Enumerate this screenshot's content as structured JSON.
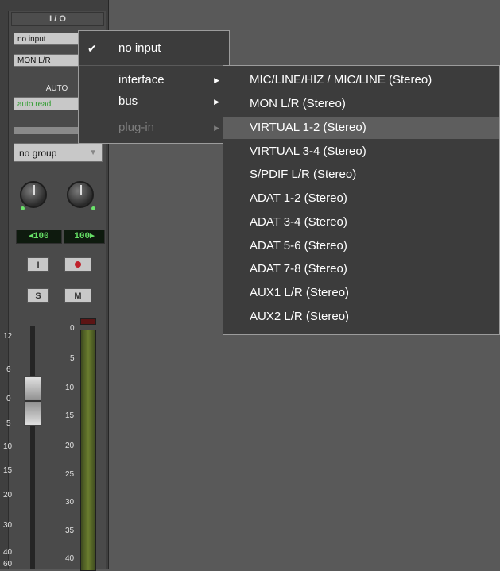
{
  "io": {
    "title": "I / O",
    "input_button": "no input",
    "output_button": "MON L/R"
  },
  "automation": {
    "title": "AUTO",
    "mode": "auto read"
  },
  "group": {
    "label": "no group"
  },
  "pan": {
    "left": "◂100",
    "right": "100▸"
  },
  "buttons": {
    "input_monitor": "I",
    "solo": "S",
    "mute": "M"
  },
  "fader_scale": [
    "12",
    "6",
    "0",
    "5",
    "10",
    "15",
    "20",
    "30",
    "40",
    "60"
  ],
  "meter_scale": [
    "0",
    "5",
    "10",
    "15",
    "20",
    "25",
    "30",
    "35",
    "40"
  ],
  "input_menu": {
    "items": [
      {
        "label": "no input",
        "checked": true,
        "submenu": false,
        "enabled": true
      },
      {
        "label": "interface",
        "checked": false,
        "submenu": true,
        "enabled": true
      },
      {
        "label": "bus",
        "checked": false,
        "submenu": true,
        "enabled": true
      },
      {
        "label": "plug-in",
        "checked": false,
        "submenu": true,
        "enabled": false
      }
    ]
  },
  "interface_submenu": {
    "selected_index": 2,
    "items": [
      "MIC/LINE/HIZ / MIC/LINE (Stereo)",
      "MON L/R (Stereo)",
      "VIRTUAL 1-2 (Stereo)",
      "VIRTUAL 3-4 (Stereo)",
      "S/PDIF L/R (Stereo)",
      "ADAT 1-2 (Stereo)",
      "ADAT 3-4 (Stereo)",
      "ADAT 5-6 (Stereo)",
      "ADAT 7-8 (Stereo)",
      "AUX1 L/R (Stereo)",
      "AUX2 L/R (Stereo)"
    ]
  },
  "colors": {
    "menu_bg": "#3c3c3c",
    "highlight": "#5e5e5e",
    "workspace": "#595959",
    "auto_text": "#2f9d2f",
    "pan_text": "#66e066",
    "record": "#c0212b"
  }
}
